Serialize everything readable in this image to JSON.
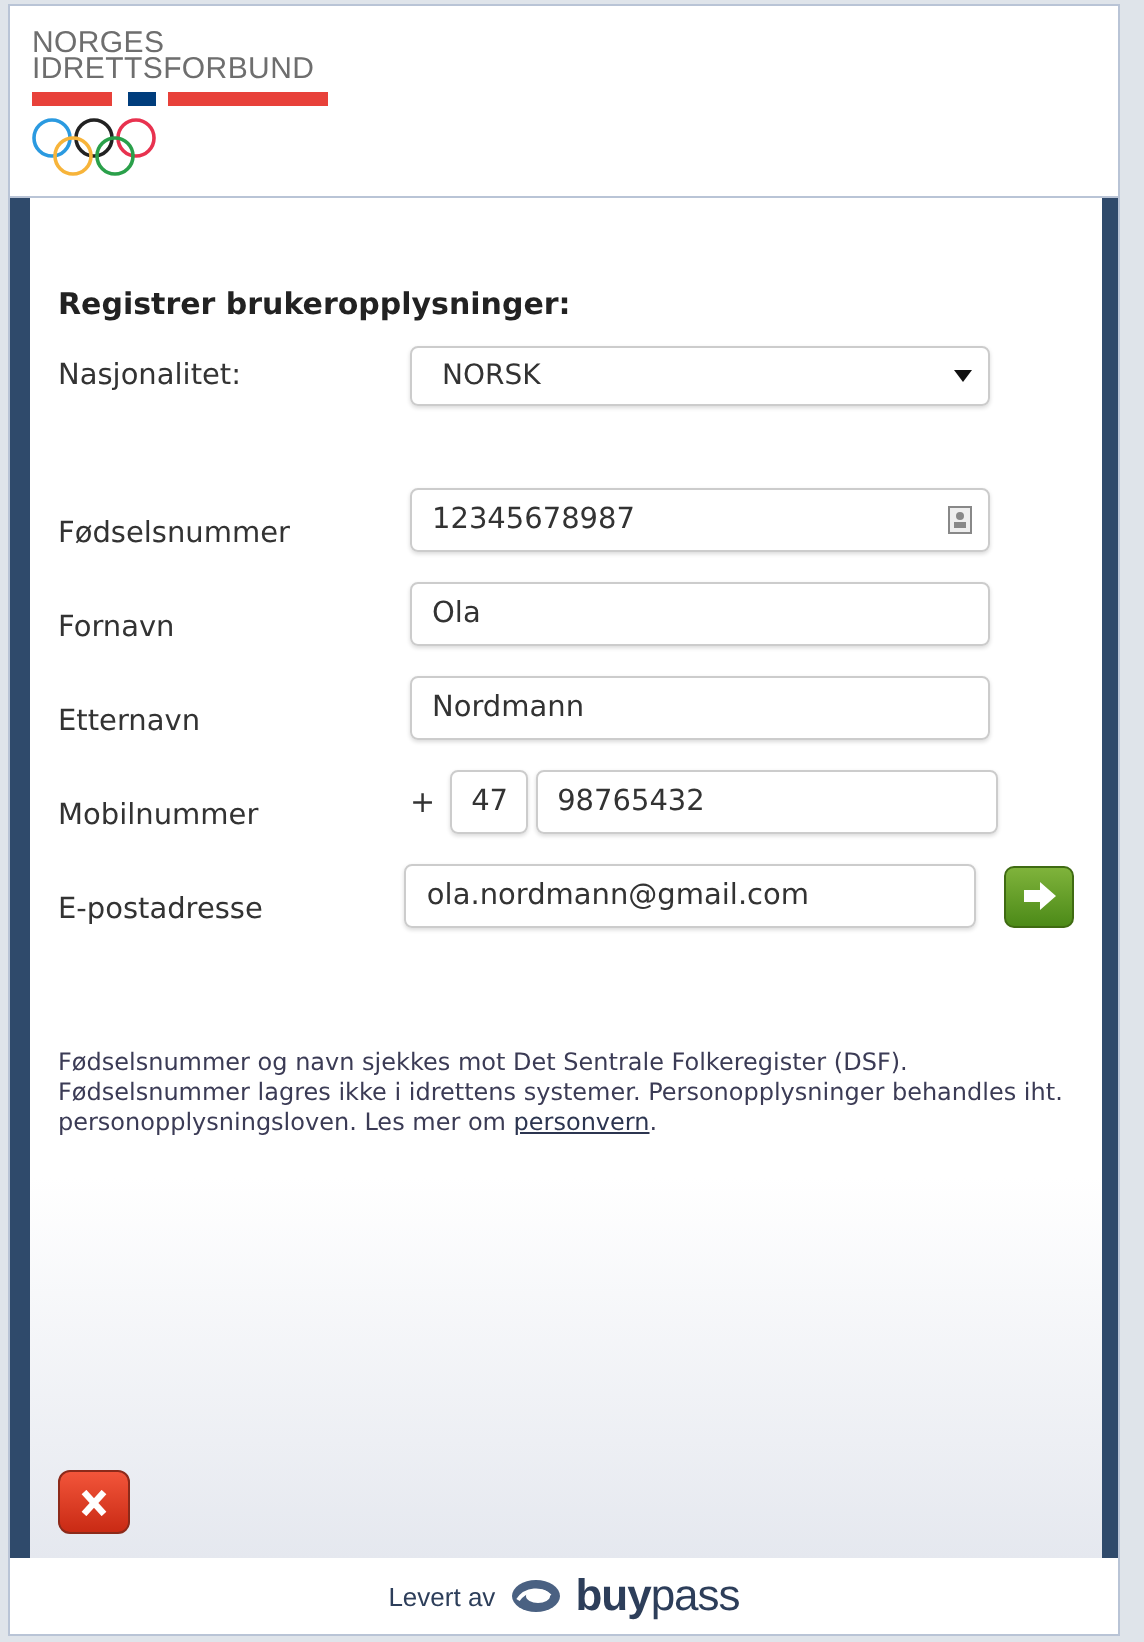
{
  "logo": {
    "line_1": "NORGES",
    "line_2": "IDRETTSFORBUND"
  },
  "form": {
    "title": "Registrer brukeropplysninger:",
    "nationality": {
      "label": "Nasjonalitet:",
      "value": "NORSK"
    },
    "fields": [
      {
        "kind": "id",
        "label": "Fødselsnummer",
        "value": "12345678987"
      },
      {
        "kind": "text",
        "label": "Fornavn",
        "value": "Ola"
      },
      {
        "kind": "text",
        "label": "Etternavn",
        "value": "Nordmann"
      },
      {
        "kind": "phone",
        "label": "Mobilnummer",
        "prefix": "+",
        "country_code": "47",
        "value": "98765432"
      },
      {
        "kind": "submit",
        "label": "E-postadresse",
        "value": "ola.nordmann@gmail.com"
      }
    ],
    "notice": "Fødselsnummer og navn sjekkes mot Det Sentrale Folkeregister (DSF). Fødselsnummer lagres ikke i idrettens systemer. Personopplysninger behandles iht. personopplysningsloven. Les mer om ",
    "notice_link": "personvern",
    "notice_end": "."
  },
  "footer": {
    "label": "Levert av",
    "brand": "**buy**pass"
  }
}
